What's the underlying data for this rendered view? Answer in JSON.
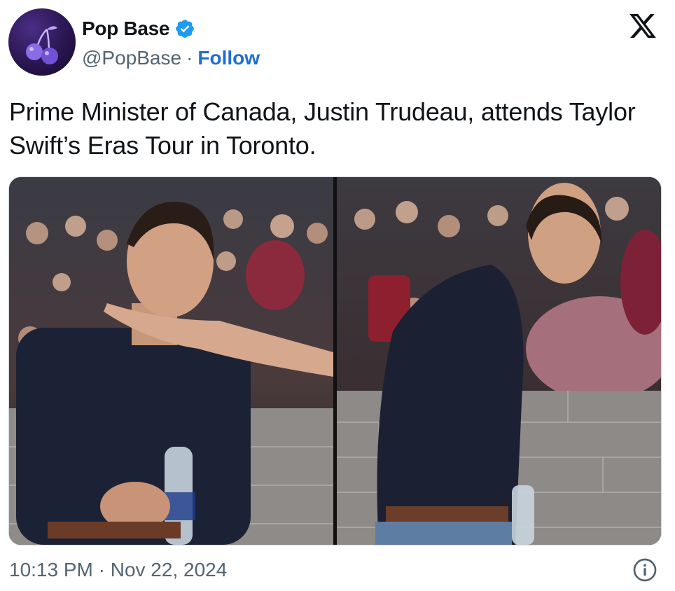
{
  "author": {
    "display_name": "Pop Base",
    "handle": "@PopBase",
    "separator": "·",
    "follow_label": "Follow",
    "verified": true,
    "avatar_icon": "cherry-icon"
  },
  "tweet": {
    "text": "Prime Minister of Canada, Justin Trudeau, attends Taylor Swift’s Eras Tour in Toronto.",
    "photos": [
      {
        "description_icon": "photo-concert-left"
      },
      {
        "description_icon": "photo-concert-right"
      }
    ]
  },
  "footer": {
    "timestamp": "10:13 PM · Nov 22, 2024",
    "info_icon": "info-icon"
  },
  "branding": {
    "logo_icon": "x-logo-icon"
  },
  "colors": {
    "verified_blue": "#1d9bf0",
    "follow_blue": "#1d6fd6",
    "secondary_text": "#536471",
    "primary_text": "#0f1419"
  }
}
